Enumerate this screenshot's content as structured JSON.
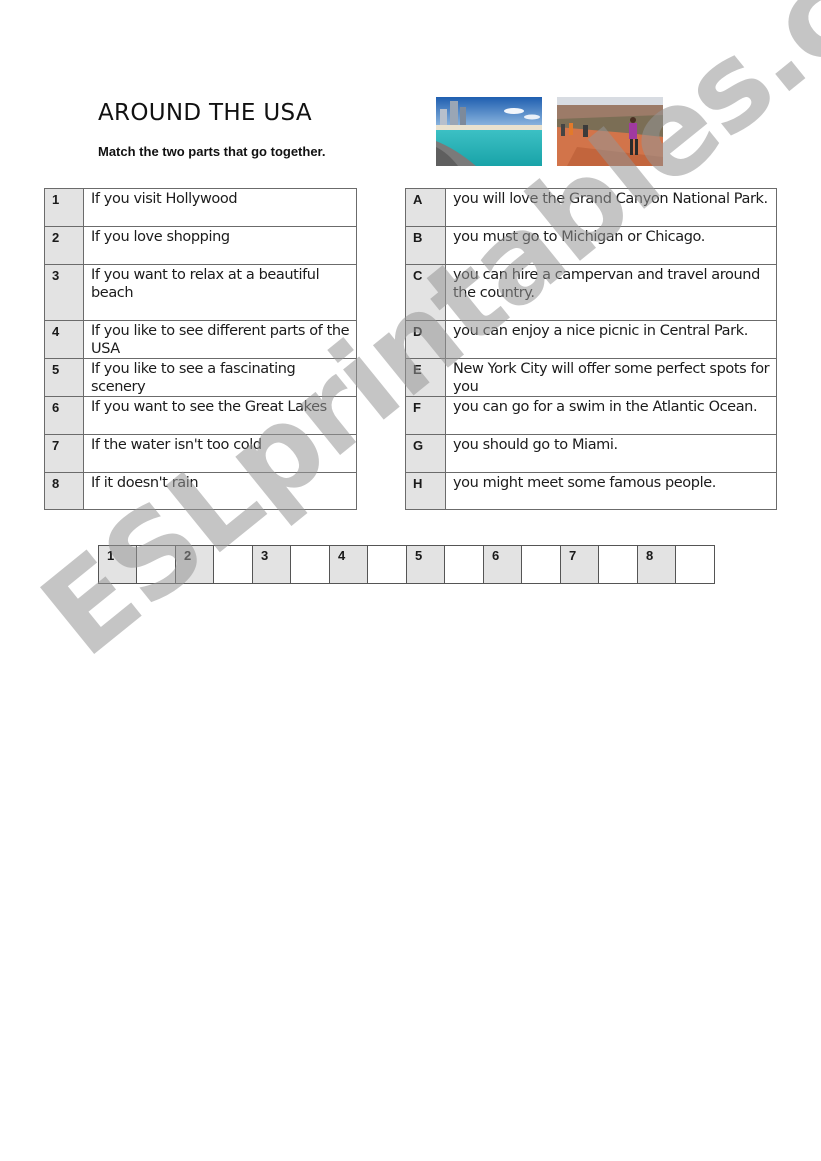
{
  "title": "AROUND THE USA",
  "instruction": "Match the two parts that go together.",
  "images": [
    {
      "name": "miami-beach-photo",
      "description": "Miami beach with skyscrapers and turquoise water"
    },
    {
      "name": "grand-canyon-photo",
      "description": "Hikers on a trail at the Grand Canyon"
    }
  ],
  "left_column": [
    {
      "key": "1",
      "text": "If you visit Hollywood"
    },
    {
      "key": "2",
      "text": "If you love shopping"
    },
    {
      "key": "3",
      "text": "If you want to relax at a beautiful beach"
    },
    {
      "key": "4",
      "text": "If you like to see different parts of the USA"
    },
    {
      "key": "5",
      "text": "If you like to see a fascinating scenery"
    },
    {
      "key": "6",
      "text": "If you want to see the Great Lakes"
    },
    {
      "key": "7",
      "text": "If the water isn't too cold"
    },
    {
      "key": "8",
      "text": "If it doesn't rain"
    }
  ],
  "right_column": [
    {
      "key": "A",
      "text": "you will love the Grand Canyon National Park."
    },
    {
      "key": "B",
      "text": "you must go to Michigan or Chicago."
    },
    {
      "key": "C",
      "text": "you can hire a campervan and travel around the country."
    },
    {
      "key": "D",
      "text": "you can enjoy a nice picnic in Central Park."
    },
    {
      "key": "E",
      "text": "New York City will offer some perfect spots for you"
    },
    {
      "key": "F",
      "text": "you can go for a swim in the Atlantic Ocean."
    },
    {
      "key": "G",
      "text": "you should go to Miami."
    },
    {
      "key": "H",
      "text": "you might meet some famous people."
    }
  ],
  "answer_grid": [
    {
      "number": "1",
      "answer": ""
    },
    {
      "number": "2",
      "answer": ""
    },
    {
      "number": "3",
      "answer": ""
    },
    {
      "number": "4",
      "answer": ""
    },
    {
      "number": "5",
      "answer": ""
    },
    {
      "number": "6",
      "answer": ""
    },
    {
      "number": "7",
      "answer": ""
    },
    {
      "number": "8",
      "answer": ""
    }
  ],
  "watermark": "ESLprintables.com"
}
